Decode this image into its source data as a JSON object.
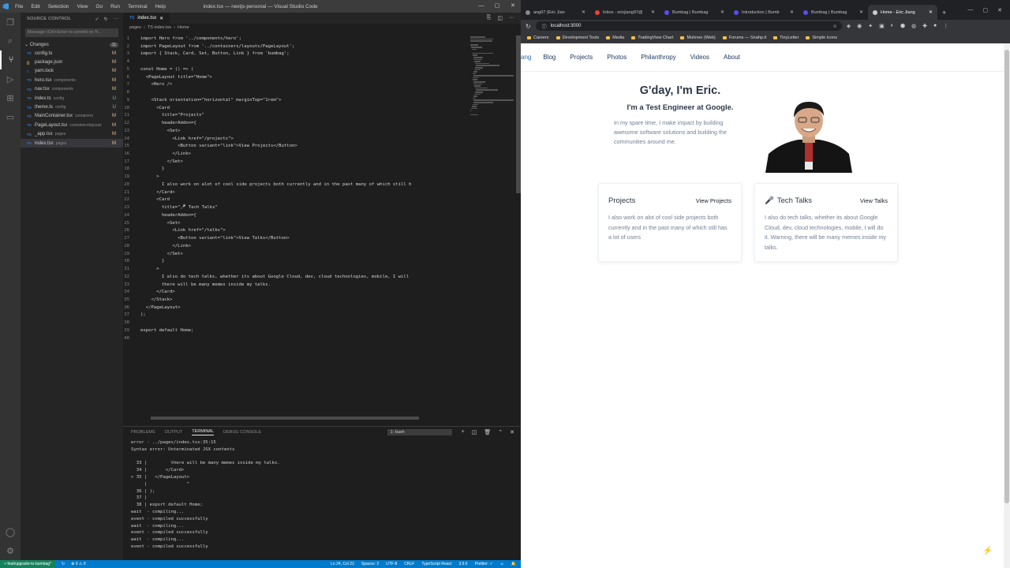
{
  "vscode": {
    "window_title": "index.tsx — nextjs-personal — Visual Studio Code",
    "menu": [
      "File",
      "Edit",
      "Selection",
      "View",
      "Go",
      "Run",
      "Terminal",
      "Help"
    ],
    "source_control": {
      "header": "SOURCE CONTROL",
      "commit_placeholder": "Message (Ctrl+Enter to commit on 'fi...",
      "changes_label": "Changes",
      "changes_count": "11",
      "files": [
        {
          "type": "TS",
          "name": "config.ts",
          "dir": "",
          "status": "M"
        },
        {
          "type": "{}",
          "name": "package.json",
          "dir": "",
          "status": "M"
        },
        {
          "type": "≡",
          "name": "yarn.lock",
          "dir": "",
          "status": "M"
        },
        {
          "type": "TS",
          "name": "hero.tsx",
          "dir": "components",
          "status": "M"
        },
        {
          "type": "TS",
          "name": "nav.tsx",
          "dir": "components",
          "status": "M"
        },
        {
          "type": "TS",
          "name": "index.ts",
          "dir": "config",
          "status": "U"
        },
        {
          "type": "TS",
          "name": "theme.ts",
          "dir": "config",
          "status": "U"
        },
        {
          "type": "TS",
          "name": "MainContainer.tsx",
          "dir": "containers",
          "status": "M"
        },
        {
          "type": "TS",
          "name": "PageLayout.tsx",
          "dir": "containers\\layouts",
          "status": "M"
        },
        {
          "type": "TS",
          "name": "_app.tsx",
          "dir": "pages",
          "status": "M"
        },
        {
          "type": "TS",
          "name": "index.tsx",
          "dir": "pages",
          "status": "M"
        }
      ]
    },
    "editor_tab": "index.tsx",
    "breadcrumb": [
      "pages",
      "TS index.tsx",
      "Home"
    ],
    "code_lines": [
      "import Hero from '../components/hero';",
      "import PageLayout from '../containers/layouts/PageLayout';",
      "import { Stack, Card, Set, Button, Link } from 'bumbag';",
      "",
      "const Home = () => (",
      "  <PageLayout title=\"Home\">",
      "    <Hero />",
      "",
      "    <Stack orientation=\"horizontal\" marginTop=\"1rem\">",
      "      <Card",
      "        title=\"Projects\"",
      "        headerAddon={",
      "          <Set>",
      "            <Link href=\"/projects\">",
      "              <Button variant=\"link\">View Projects</Button>",
      "            </Link>",
      "          </Set>",
      "        }",
      "      >",
      "        I also work on alot of cool side projects both currently and in the past many of which still h",
      "      </Card>",
      "      <Card",
      "        title=\"🎤 Tech Talks\"",
      "        headerAddon={",
      "          <Set>",
      "            <Link href=\"/talks\">",
      "              <Button variant=\"link\">View Talks</Button>",
      "            </Link>",
      "          </Set>",
      "        }",
      "      >",
      "        I also do tech talks, whether its about Google Cloud, dev, cloud technologies, mobile, I will",
      "        there will be many memes inside my talks.",
      "      </Card>",
      "    </Stack>",
      "  </PageLayout>",
      ");",
      "",
      "export default Home;",
      ""
    ],
    "panel_tabs": [
      "PROBLEMS",
      "OUTPUT",
      "TERMINAL",
      "DEBUG CONSOLE"
    ],
    "terminal_select": "1: bash",
    "terminal_lines": [
      "error - ../pages/index.tsx:35:15",
      "Syntax error: Unterminated JSX contents",
      "",
      "  33 |         there will be many memes inside my talks.",
      "  34 |       </Card>",
      "> 35 |   </PageLayout>",
      "     |               ^",
      "  36 | );",
      "  37 |",
      "  38 | export default Home;",
      "wait  - compiling...",
      "event - compiled successfully",
      "wait  - compiling...",
      "event - compiled successfully",
      "wait  - compiling...",
      "event - compiled successfully",
      ""
    ],
    "status": {
      "branch": "feat/upgrade-to-bumbag*",
      "problems": "⊗ 0 ⚠ 0",
      "position": "Ln 24, Col 22",
      "spaces": "Spaces: 2",
      "encoding": "UTF-8",
      "eol": "CRLF",
      "language": "TypeScript React",
      "version": "3.9.6",
      "prettier": "Prettier: ✓"
    }
  },
  "browser": {
    "tabs": [
      {
        "title": "ang97 (Eric Jian",
        "color": "#888"
      },
      {
        "title": "Inbox - ericjiang97@",
        "color": "#ea4335"
      },
      {
        "title": "Bumbag | Bumbag",
        "color": "#574feb"
      },
      {
        "title": "Introduction | Bumb",
        "color": "#574feb"
      },
      {
        "title": "Bumbag | Bumbag",
        "color": "#574feb"
      },
      {
        "title": "Home - Eric Jiang",
        "color": "#ccc"
      }
    ],
    "url": "localhost:3000",
    "bookmarks": [
      "Careers",
      "Development Tools",
      "Media",
      "TradingView Chart",
      "Muhnee (Web)",
      "Forums — Snahp.it",
      "TinyLetter",
      "Simple Icons"
    ],
    "site": {
      "nav": [
        "ang",
        "Blog",
        "Projects",
        "Photos",
        "Philanthropy",
        "Videos",
        "About"
      ],
      "greeting": "G'day, I'm Eric.",
      "role": "I'm a Test Engineer at Google.",
      "intro": "In my spare time, I make impact by building awesome software solutions and building the communities around me.",
      "cards": [
        {
          "title": "Projects",
          "link": "View Projects",
          "body": "I also work on alot of cool side projects both currently and in the past many of which still has a lot of users",
          "icon": ""
        },
        {
          "title": "Tech Talks",
          "link": "View Talks",
          "body": "I also do tech talks, whether its about Google Cloud, dev, cloud technologies, mobile, I will do it. Warning, there will be many memes inside my talks.",
          "icon": "🎤"
        }
      ]
    }
  }
}
